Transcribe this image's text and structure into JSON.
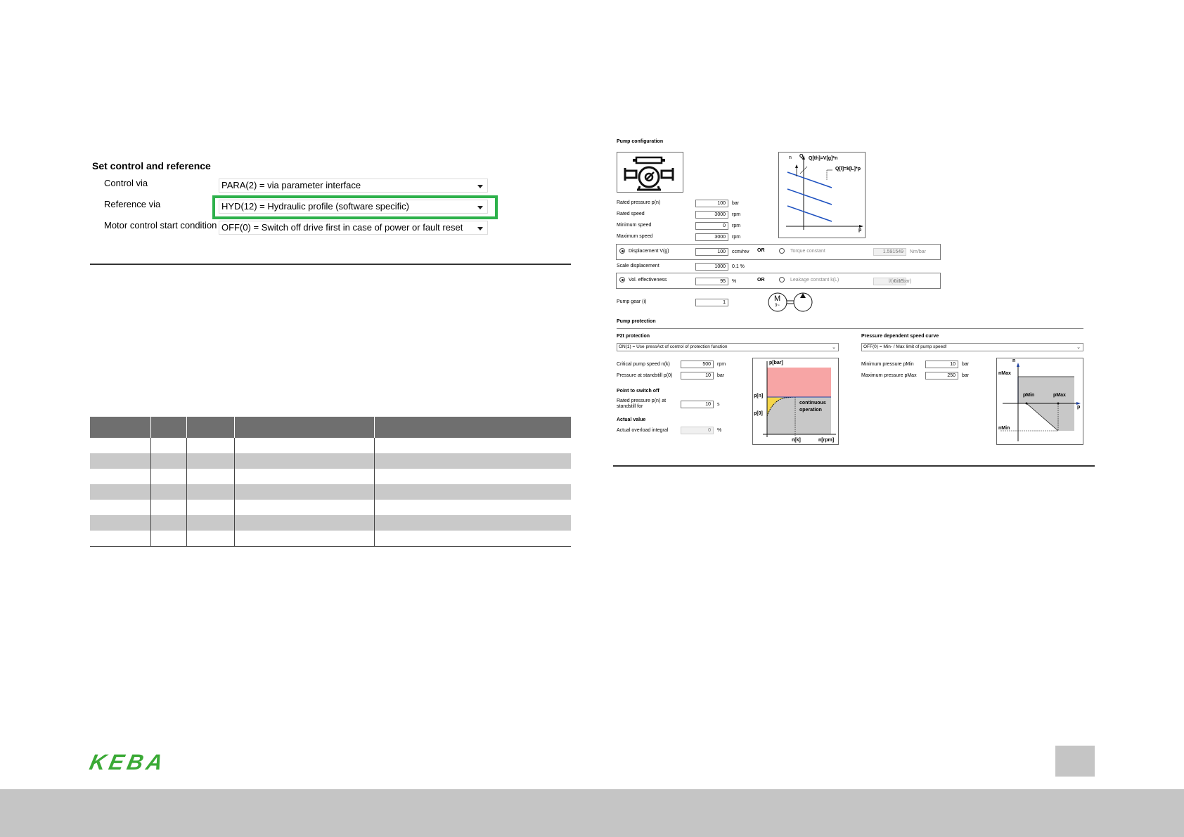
{
  "left": {
    "title": "Set control and reference",
    "rows": [
      {
        "label": "Control via",
        "value": "PARA(2) = via parameter interface"
      },
      {
        "label": "Reference via",
        "value": "HYD(12) = Hydraulic profile (software specific)"
      },
      {
        "label": "Motor control start condition",
        "value": "OFF(0) = Switch off drive first in case of power or fault reset"
      }
    ],
    "highlight_color": "#2db14b"
  },
  "right": {
    "pump_configuration": {
      "title": "Pump configuration",
      "formula_qth": "Q[th]=V[g]*n",
      "formula_ql": "Q[l]=k[L]*p",
      "axis_q": "Q",
      "axis_p": "p",
      "axis_n": "n",
      "fields": [
        {
          "label": "Rated pressure p(n)",
          "value": "100",
          "unit": "bar"
        },
        {
          "label": "Rated speed",
          "value": "3000",
          "unit": "rpm"
        },
        {
          "label": "Minimum speed",
          "value": "0",
          "unit": "rpm"
        },
        {
          "label": "Maximum speed",
          "value": "3000",
          "unit": "rpm"
        }
      ],
      "displacement": {
        "label": "Displacement V(g)",
        "value": "100",
        "unit": "ccm/rev"
      },
      "or1": "OR",
      "torque": {
        "label": "Torque constant",
        "value": "1.591549",
        "unit": "Nm/bar"
      },
      "scale": {
        "label": "Scale displacement",
        "value": "1000",
        "unit": "0.1 %"
      },
      "vol": {
        "label": "Vol. effectiveness",
        "value": "95",
        "unit": "%"
      },
      "or2": "OR",
      "leakage": {
        "label": "Leakage constant k(L)",
        "value": "0.15",
        "unit": "l/(min*bar)"
      },
      "gear": {
        "label": "Pump gear (i)",
        "value": "1"
      },
      "motor_symbol": "M",
      "motor_sub": "3~"
    },
    "pump_protection": {
      "title": "Pump protection",
      "p2t": {
        "title": "P2t protection",
        "select": "ON(1) = Use pressAct of control of protection function",
        "critical": {
          "label": "Critical pump speed n(k)",
          "value": "500",
          "unit": "rpm"
        },
        "standstill": {
          "label": "Pressure at standstill p(0)",
          "value": "10",
          "unit": "bar"
        },
        "switch_off_title": "Point to switch off",
        "rated_label_1": "Rated pressure p(n) at",
        "rated_label_2": "standstill for",
        "rated_value": "10",
        "rated_unit": "s",
        "actual_title": "Actual value",
        "actual": {
          "label": "Actual overload integral",
          "value": "0",
          "unit": "%"
        },
        "diagram": {
          "y_label": "p[bar]",
          "p_n": "p[n]",
          "p_0": "p[0]",
          "n_k": "n[k]",
          "n_rpm": "n[rpm]",
          "text1": "continuous",
          "text2": "operation",
          "color_red": "#f7a5a5",
          "color_yellow": "#f5d64a",
          "color_grey": "#c8c8c8"
        }
      },
      "speed_curve": {
        "title": "Pressure dependent speed curve",
        "select": "OFF(0) = Min- / Max limit of pump speed!",
        "pmin": {
          "label": "Minimum pressure pMin",
          "value": "10",
          "unit": "bar"
        },
        "pmax": {
          "label": "Maximum pressure pMax",
          "value": "250",
          "unit": "bar"
        },
        "diagram": {
          "n": "n",
          "nmax": "nMax",
          "nmin": "nMin",
          "pmin": "pMin",
          "pmax": "pMax",
          "p": "p"
        }
      }
    }
  },
  "brand": {
    "logo": "KEBA",
    "logo_color": "#3aa935"
  }
}
